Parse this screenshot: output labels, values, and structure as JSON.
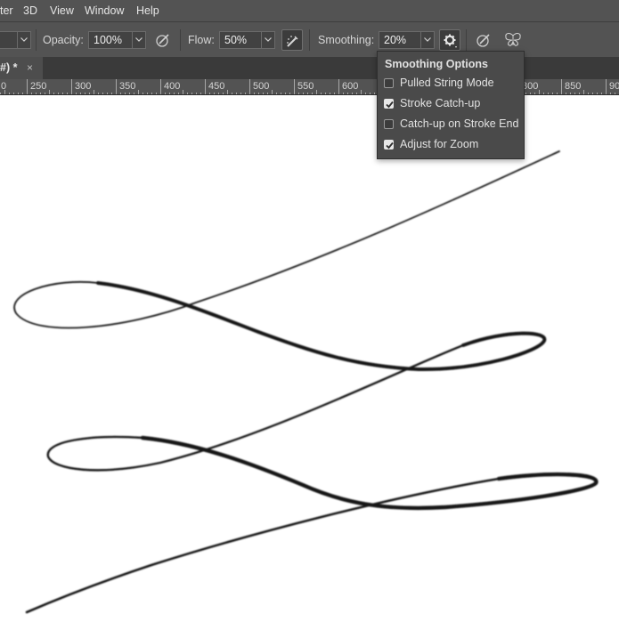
{
  "menu": [
    "ter",
    "3D",
    "View",
    "Window",
    "Help"
  ],
  "options": {
    "opacity_label": "Opacity:",
    "opacity_value": "100%",
    "flow_label": "Flow:",
    "flow_value": "50%",
    "smoothing_label": "Smoothing:",
    "smoothing_value": "20%"
  },
  "tab": {
    "title": "#) *",
    "close": "×"
  },
  "ruler": [
    "0",
    "250",
    "300",
    "350",
    "400",
    "450",
    "500",
    "550",
    "600",
    "800",
    "850",
    "90"
  ],
  "smoothing_menu": {
    "title": "Smoothing Options",
    "items": [
      {
        "label": "Pulled String Mode",
        "checked": false
      },
      {
        "label": "Stroke Catch-up",
        "checked": true
      },
      {
        "label": "Catch-up on Stroke End",
        "checked": false
      },
      {
        "label": "Adjust for Zoom",
        "checked": true
      }
    ]
  },
  "icons": [
    "chevron-down-icon",
    "pressure-opacity-icon",
    "airbrush-icon",
    "gear-icon",
    "pressure-size-icon",
    "symmetry-butterfly-icon",
    "close-icon",
    "checkmark-icon"
  ]
}
